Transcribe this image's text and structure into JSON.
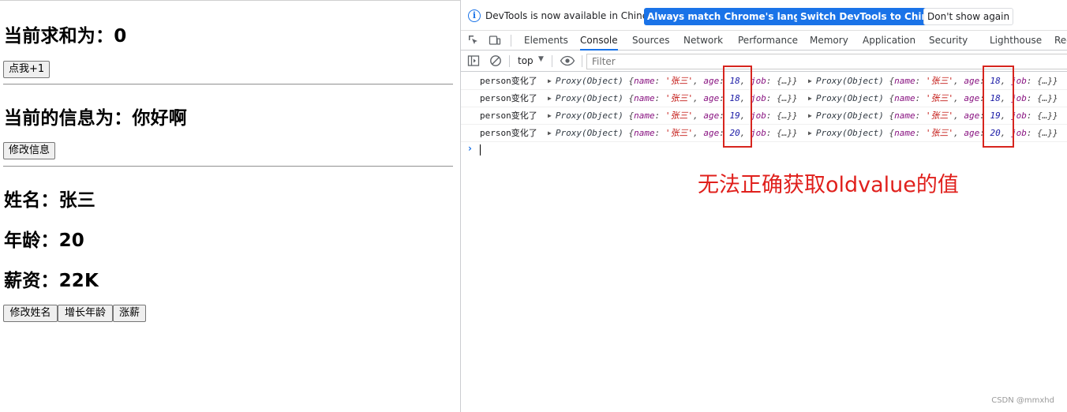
{
  "left_page": {
    "sum_heading": "当前求和为：0",
    "add_button": "点我+1",
    "message_heading": "当前的信息为：你好啊",
    "edit_message_button": "修改信息",
    "name_heading": "姓名：张三",
    "age_heading": "年龄：20",
    "salary_heading": "薪资：22K",
    "buttons": [
      "修改姓名",
      "增长年龄",
      "涨薪"
    ]
  },
  "devtools": {
    "infobar": {
      "icon": "info-icon",
      "message": "DevTools is now available in Chinese!",
      "match_language_button": "Always match Chrome's language",
      "switch_button": "Switch DevTools to Chinese",
      "dismiss_button": "Don't show again"
    },
    "tabs": [
      "Elements",
      "Console",
      "Sources",
      "Network",
      "Performance",
      "Memory",
      "Application",
      "Security",
      "Lighthouse",
      "Rec"
    ],
    "active_tab": "Console",
    "toolbar": {
      "context": "top",
      "filter_placeholder": "Filter"
    },
    "console_rows": [
      {
        "prefix": "person变化了",
        "new": {
          "label": "Proxy(Object)",
          "name": "'张三'",
          "age": "18"
        },
        "old": {
          "label": "Proxy(Object)",
          "name": "'张三'",
          "age": "18"
        }
      },
      {
        "prefix": "person变化了",
        "new": {
          "label": "Proxy(Object)",
          "name": "'张三'",
          "age": "18"
        },
        "old": {
          "label": "Proxy(Object)",
          "name": "'张三'",
          "age": "18"
        }
      },
      {
        "prefix": "person变化了",
        "new": {
          "label": "Proxy(Object)",
          "name": "'张三'",
          "age": "19"
        },
        "old": {
          "label": "Proxy(Object)",
          "name": "'张三'",
          "age": "19"
        }
      },
      {
        "prefix": "person变化了",
        "new": {
          "label": "Proxy(Object)",
          "name": "'张三'",
          "age": "20"
        },
        "old": {
          "label": "Proxy(Object)",
          "name": "'张三'",
          "age": "20"
        }
      }
    ],
    "prompt_symbol": "›"
  },
  "annotation": {
    "text": "无法正确获取oldvalue的值",
    "color": "#e0201c"
  },
  "watermark": "CSDN @mmxhd",
  "colors": {
    "devtools_accent": "#1a73e8",
    "highlight_box": "#d7251e"
  }
}
